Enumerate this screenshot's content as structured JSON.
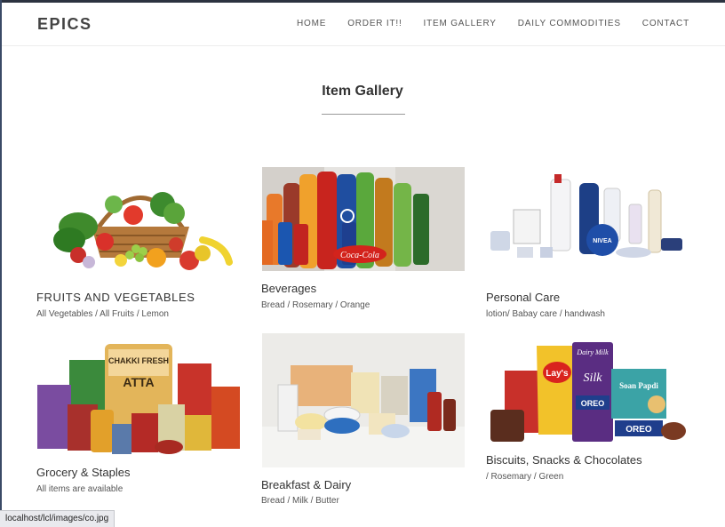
{
  "brand": "EPICS",
  "nav": [
    "HOME",
    "ORDER IT!!",
    "ITEM GALLERY",
    "DAILY COMMODITIES",
    "CONTACT"
  ],
  "section_title": "Item Gallery",
  "items": [
    {
      "name": "FRUITS AND VEGETABLES",
      "sub": "All Vegetables / All Fruits / Lemon"
    },
    {
      "name": "Beverages",
      "sub": "Bread / Rosemary / Orange"
    },
    {
      "name": "Personal Care",
      "sub": "lotion/ Babay care / handwash"
    },
    {
      "name": "Grocery & Staples",
      "sub": "All items are available"
    },
    {
      "name": "Breakfast & Dairy",
      "sub": "Bread / Milk / Butter"
    },
    {
      "name": "Biscuits, Snacks & Chocolates",
      "sub": "/ Rosemary / Green"
    }
  ],
  "image_labels": {
    "cola": "Coca-Cola",
    "atta_brand": "CHAKKI FRESH",
    "atta": "ATTA",
    "lays": "Lay's",
    "silk": "Silk",
    "oreo": "OREO",
    "nivea": "NIVEA",
    "dairy_milk": "Dairy Milk",
    "soan_papdi": "Soan Papdi"
  },
  "status_url": "localhost/lcl/images/co.jpg"
}
